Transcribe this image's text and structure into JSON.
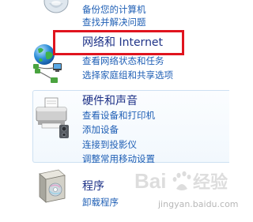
{
  "system_category": {
    "links": [
      "备份您的计算机",
      "查找并解决问题"
    ]
  },
  "network_category": {
    "title": "网络和 Internet",
    "links": [
      "查看网络状态和任务",
      "选择家庭组和共享选项"
    ]
  },
  "hardware_category": {
    "title": "硬件和声音",
    "links": [
      "查看设备和打印机",
      "添加设备",
      "连接到投影仪",
      "调整常用移动设置"
    ]
  },
  "programs_category": {
    "title": "程序",
    "links": [
      "卸载程序"
    ]
  },
  "watermark": {
    "site": "jingyan.baidu.com"
  },
  "colors": {
    "title": "#1e3287",
    "link": "#1f5fb5",
    "highlight": "#e0141e"
  },
  "icons": [
    "system-security-icon",
    "network-globe-icon",
    "printer-icon",
    "programs-box-icon"
  ]
}
